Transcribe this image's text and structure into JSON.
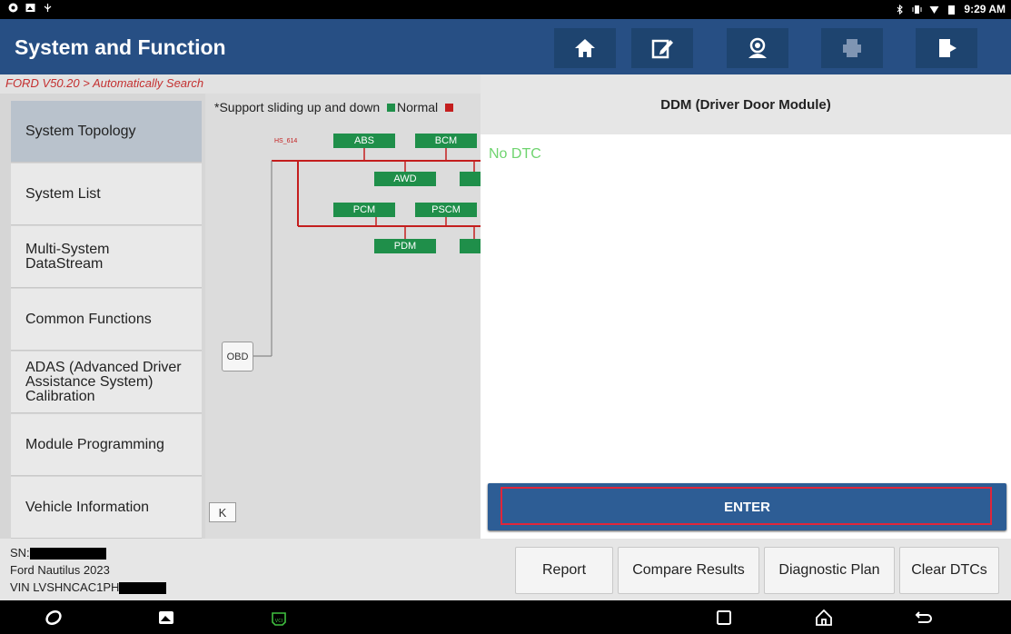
{
  "status_bar": {
    "time": "9:29 AM"
  },
  "header": {
    "title": "System and Function",
    "buttons": [
      "home-icon",
      "edit-icon",
      "support-icon",
      "print-icon",
      "exit-icon"
    ]
  },
  "breadcrumb": "FORD V50.20 > Automatically Search",
  "sidebar": {
    "items": [
      {
        "label": "System Topology"
      },
      {
        "label": "System List"
      },
      {
        "label": "Multi-System DataStream"
      },
      {
        "label": "Common Functions"
      },
      {
        "label": "ADAS (Advanced Driver Assistance System) Calibration"
      },
      {
        "label": "Module Programming"
      },
      {
        "label": "Vehicle Information"
      }
    ]
  },
  "topology": {
    "note": "*Support sliding up and down",
    "legend_normal": "Normal",
    "bus_label": "HS_614",
    "modules": [
      "ABS",
      "BCM",
      "AWD",
      "PCM",
      "PSCM",
      "PDM"
    ],
    "obd": "OBD",
    "collapse": "K",
    "colors": {
      "module": "#1f8f4a",
      "bus": "#c41e1e"
    }
  },
  "panel": {
    "title": "DDM (Driver Door Module)",
    "status": "No DTC",
    "enter": "ENTER"
  },
  "footer": {
    "sn_label": "SN:",
    "vehicle": "Ford Nautilus 2023",
    "vin_label": "VIN LVSHNCAC1PH",
    "buttons": {
      "report": "Report",
      "compare": "Compare Results",
      "plan": "Diagnostic Plan",
      "clear": "Clear DTCs"
    }
  },
  "navbar": {
    "icons": [
      "browser-icon",
      "gallery-icon",
      "vci-icon",
      "recents-icon",
      "home-nav-icon",
      "back-icon"
    ]
  }
}
